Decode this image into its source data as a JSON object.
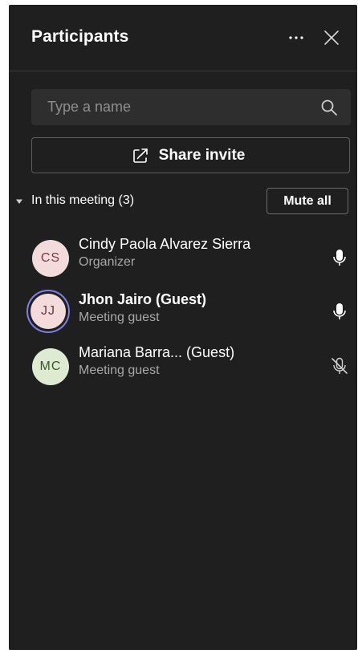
{
  "panel": {
    "title": "Participants"
  },
  "search": {
    "placeholder": "Type a name"
  },
  "share": {
    "label": "Share invite"
  },
  "section": {
    "label": "In this meeting (3)",
    "mute_all_label": "Mute all"
  },
  "participants": [
    {
      "initials": "CS",
      "name": "Cindy Paola Alvarez Sierra",
      "role": "Organizer",
      "mic": "unmuted"
    },
    {
      "initials": "JJ",
      "name": "Jhon Jairo (Guest)",
      "role": "Meeting guest",
      "mic": "unmuted",
      "speaking": true
    },
    {
      "initials": "MC",
      "name": "Mariana Barra...  (Guest)",
      "role": "Meeting guest",
      "mic": "muted"
    }
  ],
  "colors": {
    "background": "#1f1f1f",
    "speaking_ring": "#7e7ee4",
    "avatar_pink": "#f3dadb",
    "avatar_green": "#dfead2"
  },
  "icons": [
    "more-icon",
    "close-icon",
    "search-icon",
    "share-icon",
    "caret-down-icon",
    "microphone-icon",
    "microphone-off-icon"
  ]
}
